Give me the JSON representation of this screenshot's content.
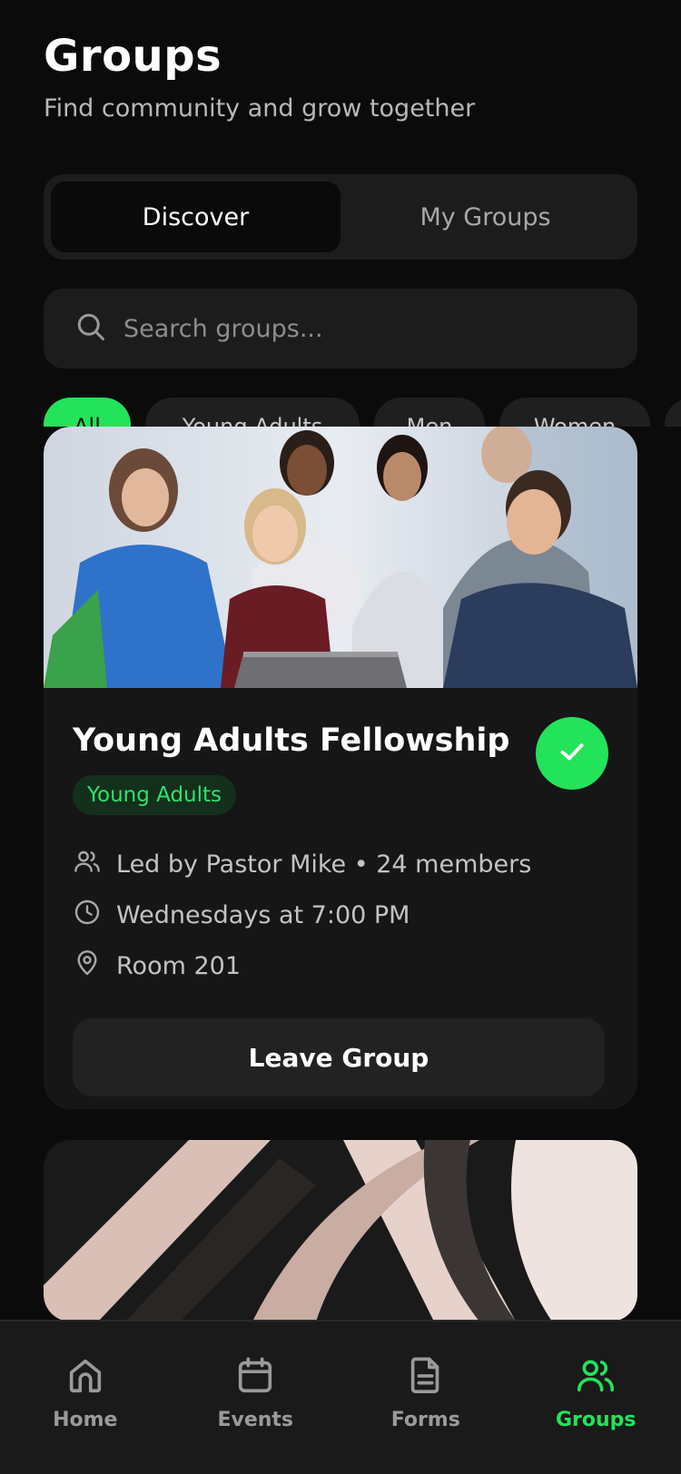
{
  "header": {
    "title": "Groups",
    "subtitle": "Find community and grow together"
  },
  "segment": {
    "tabs": [
      {
        "label": "Discover",
        "active": true
      },
      {
        "label": "My Groups",
        "active": false
      }
    ]
  },
  "search": {
    "placeholder": "Search groups...",
    "icon": "search-icon"
  },
  "filters": {
    "chips": [
      {
        "label": "All",
        "active": true
      },
      {
        "label": "Young Adults",
        "active": false
      },
      {
        "label": "Men",
        "active": false
      },
      {
        "label": "Women",
        "active": false
      }
    ]
  },
  "groups": [
    {
      "title": "Young Adults Fellowship",
      "category": "Young Adults",
      "leader_members": "Led by Pastor Mike • 24 members",
      "schedule": "Wednesdays at 7:00 PM",
      "location": "Room 201",
      "joined": true,
      "action_label": "Leave Group"
    }
  ],
  "tabbar": {
    "items": [
      {
        "label": "Home",
        "icon": "home-icon",
        "active": false
      },
      {
        "label": "Events",
        "icon": "calendar-icon",
        "active": false
      },
      {
        "label": "Forms",
        "icon": "document-icon",
        "active": false
      },
      {
        "label": "Groups",
        "icon": "users-icon",
        "active": true
      }
    ]
  },
  "colors": {
    "accent": "#22e35a",
    "background": "#0b0b0b",
    "card": "#161616"
  }
}
